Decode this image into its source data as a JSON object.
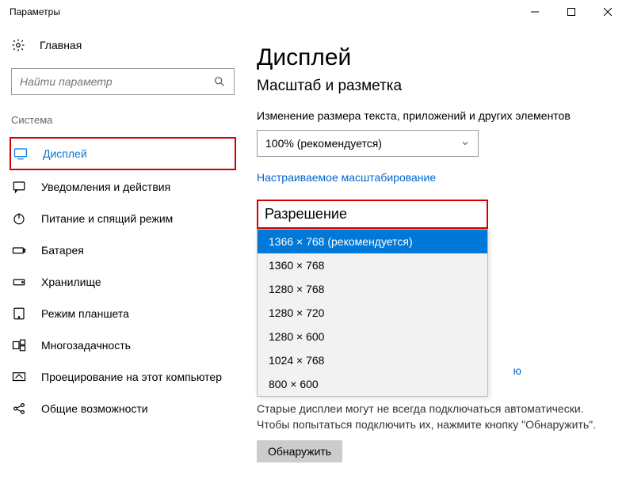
{
  "window": {
    "title": "Параметры"
  },
  "sidebar": {
    "home": "Главная",
    "search_placeholder": "Найти параметр",
    "category": "Система",
    "items": [
      {
        "label": "Дисплей"
      },
      {
        "label": "Уведомления и действия"
      },
      {
        "label": "Питание и спящий режим"
      },
      {
        "label": "Батарея"
      },
      {
        "label": "Хранилище"
      },
      {
        "label": "Режим планшета"
      },
      {
        "label": "Многозадачность"
      },
      {
        "label": "Проецирование на этот компьютер"
      },
      {
        "label": "Общие возможности"
      }
    ]
  },
  "main": {
    "heading": "Дисплей",
    "subheading": "Масштаб и разметка",
    "scale_label": "Изменение размера текста, приложений и других элементов",
    "scale_value": "100% (рекомендуется)",
    "custom_scaling_link": "Настраиваемое масштабирование",
    "resolution_heading": "Разрешение",
    "resolution_options": [
      "1366 × 768 (рекомендуется)",
      "1360 × 768",
      "1280 × 768",
      "1280 × 720",
      "1280 × 600",
      "1024 × 768",
      "800 × 600"
    ],
    "behind_link_piece": "ю",
    "behind_text": "Старые дисплеи могут не всегда подключаться автоматически. Чтобы попытаться подключить их, нажмите кнопку \"Обнаружить\".",
    "detect_button": "Обнаружить"
  }
}
